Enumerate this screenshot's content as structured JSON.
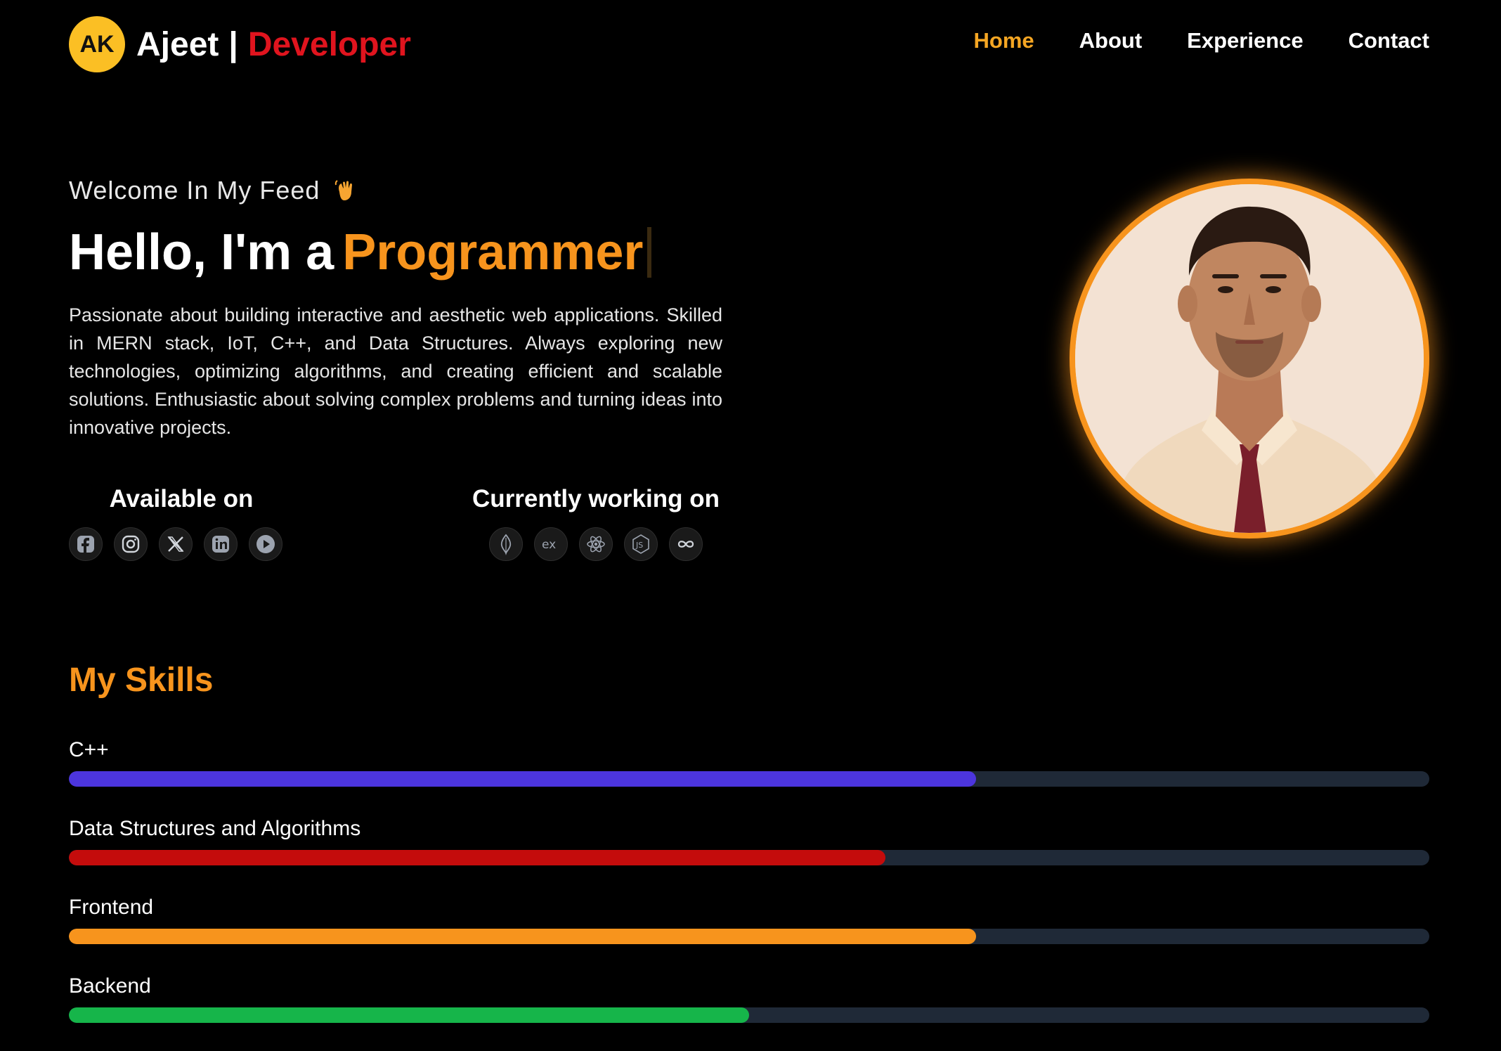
{
  "header": {
    "brand_badge": "AK",
    "brand_name": "Ajeet",
    "brand_separator": "|",
    "brand_role": "Developer",
    "nav": [
      {
        "label": "Home",
        "active": true
      },
      {
        "label": "About",
        "active": false
      },
      {
        "label": "Experience",
        "active": false
      },
      {
        "label": "Contact",
        "active": false
      }
    ]
  },
  "hero": {
    "welcome": "Welcome In My Feed",
    "welcome_icon": "waving-hand-icon",
    "greeting": "Hello, I'm a",
    "role": "Programmer",
    "intro": "Passionate about building interactive and aesthetic web applications. Skilled in MERN stack, IoT, C++, and Data Structures. Always exploring new technologies, optimizing algorithms, and creating efficient and scalable solutions. Enthusiastic about solving complex problems and turning ideas into innovative projects."
  },
  "available": {
    "title": "Available on",
    "icons": [
      "facebook-icon",
      "instagram-icon",
      "x-icon",
      "linkedin-icon",
      "youtube-icon"
    ]
  },
  "working": {
    "title": "Currently working on",
    "icons": [
      "mongodb-icon",
      "express-icon",
      "react-icon",
      "nodejs-icon",
      "infinity-icon"
    ]
  },
  "portrait": {
    "description_icon": "profile-photo"
  },
  "skills": {
    "title": "My Skills",
    "items": [
      {
        "label": "C++",
        "level": 0.667,
        "color": "#4c35de"
      },
      {
        "label": "Data Structures and Algorithms",
        "level": 0.6,
        "color": "#c40c0c"
      },
      {
        "label": "Frontend",
        "level": 0.667,
        "color": "#f7941d"
      },
      {
        "label": "Backend",
        "level": 0.5,
        "color": "#16b54a"
      }
    ]
  },
  "colors": {
    "accent": "#f7941d",
    "brand_badge": "#fbbf24",
    "brand_role": "#e0141e",
    "nav_active": "#f5a623",
    "track": "#1f2937"
  }
}
